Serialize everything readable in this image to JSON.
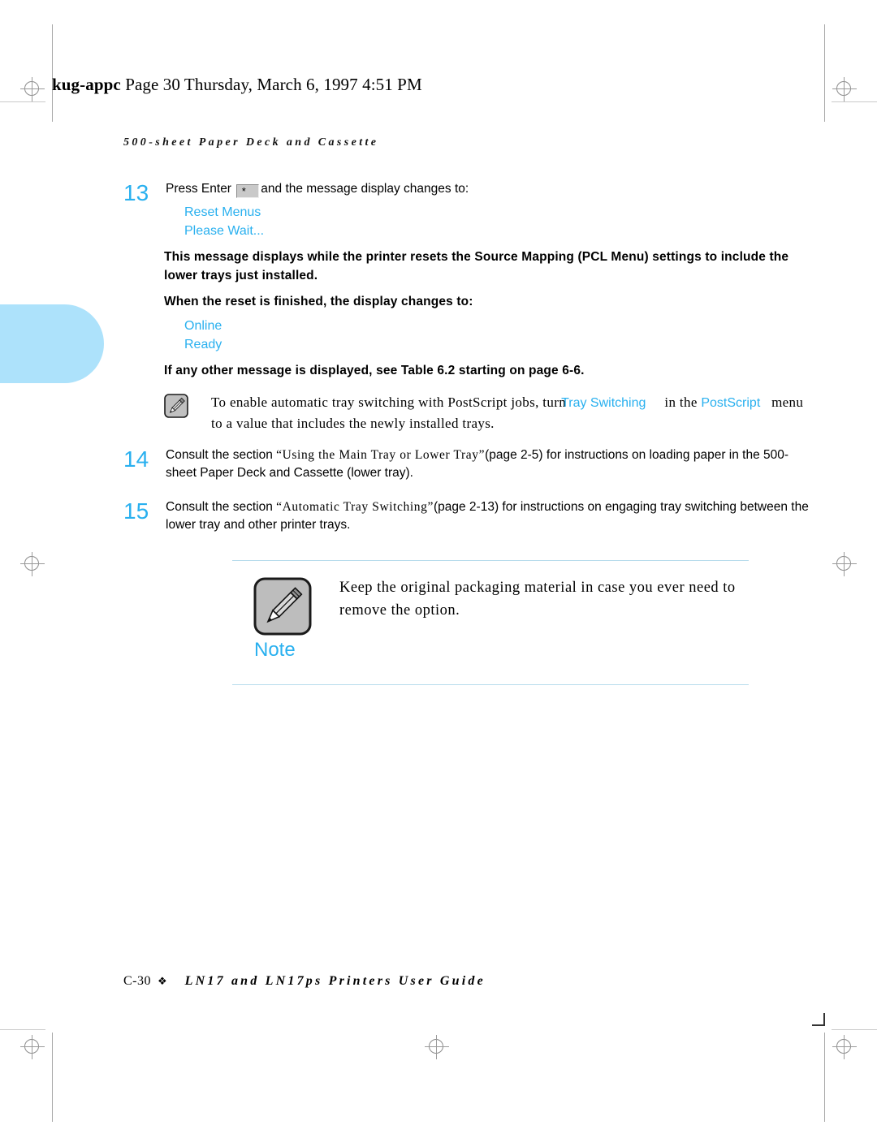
{
  "page": {
    "file_header_prefix": "kug-appc",
    "file_header_rest": "  Page 30  Thursday, March 6, 1997  4:51 PM",
    "running_head": "500-sheet Paper Deck and Cassette",
    "footer_page": "C-30",
    "footer_diamond": "❖",
    "footer_title": "LN17 and LN17ps Printers User Guide"
  },
  "colors": {
    "accent_cyan": "#29b0ef",
    "tab_blue": "#ade2fb",
    "rule_blue": "#b7dcec",
    "icon_gray": "#bfbfbf"
  },
  "steps": [
    {
      "number": "13",
      "lead_before_key": "Press Enter ",
      "key_label": "*",
      "lead_after_key": "and the message display changes to:",
      "display_lines": [
        "Reset Menus",
        "Please Wait..."
      ],
      "bold_paras": [
        "This message displays while the printer resets the Source Mapping (PCL Menu) settings to include the lower trays just installed.",
        "When the reset is finished, the display changes to:"
      ],
      "display_lines_2": [
        "Online",
        "Ready"
      ],
      "bold_para_3": "If any other message is displayed, see Table 6.2 starting on page 6-6."
    },
    {
      "number": "14",
      "text_a": "Consult the section ",
      "text_quoted": "“Using the Main Tray or Lower Tray”",
      "text_b": "(page 2-5) for instructions on loading paper in the 500-sheet Paper Deck and Cassette (lower tray)."
    },
    {
      "number": "15",
      "text_a": "Consult the section ",
      "text_quoted": "“Automatic Tray Switching”",
      "text_b": "(page 2-13) for instructions on engaging tray switching between the lower tray and other printer trays."
    }
  ],
  "inline_note": {
    "icon": "pencil-icon",
    "part1": "To enable automatic tray switching with PostScript jobs, turn",
    "highlight1": "Tray Switching",
    "part2": "in the",
    "highlight2": "PostScript",
    "part3": "menu to a value that includes the newly installed trays."
  },
  "note_box": {
    "icon": "pencil-icon",
    "label": "Note",
    "text": "Keep the original packaging material in case you ever need to remove the option."
  }
}
